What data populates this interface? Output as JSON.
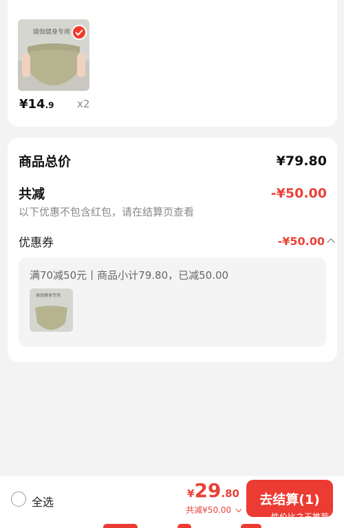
{
  "product": {
    "image_caption": "瑜伽健身专用",
    "price_int": "¥14",
    "price_dec": ".9",
    "quantity": "x2",
    "selected": true
  },
  "summary": {
    "total_label": "商品总价",
    "total_value": "¥79.80",
    "discount_label": "共减",
    "discount_value": "-¥50.00",
    "note": "以下优惠不包含红包，请在结算页查看",
    "coupon_label": "优惠券",
    "coupon_value": "-¥50.00",
    "coupon_detail": "满70减50元丨商品小计79.80，已减50.00",
    "mini_caption": "瑜伽健身专用"
  },
  "bottom_bar": {
    "select_all": "全选",
    "total_symbol": "¥",
    "total_int": "29",
    "total_dec": ".80",
    "saved": "共减¥50.00",
    "checkout": "去结算(1)",
    "recommend": "性价比之王推荐"
  },
  "colors": {
    "accent": "#ec3b32",
    "price_red": "#e8433a",
    "background": "#f3f3f3"
  }
}
